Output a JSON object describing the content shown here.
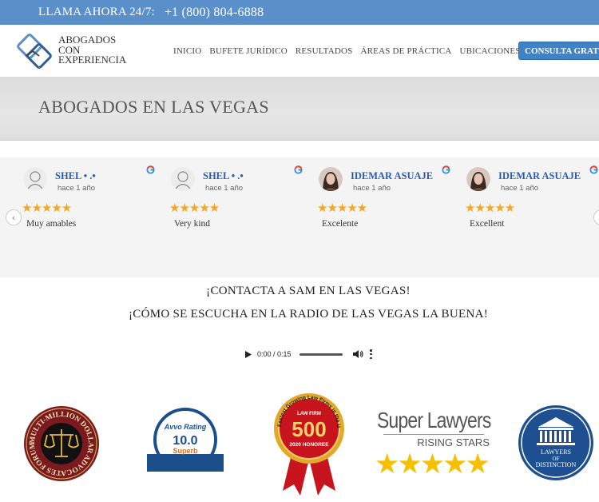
{
  "topbar": {
    "call_label": "LLAMA AHORA 24/7:",
    "phone": "+1 (800) 804-6888"
  },
  "header": {
    "logo_lines": [
      "ABOGADOS",
      "CON",
      "EXPERIENCIA"
    ],
    "nav": [
      "INICIO",
      "BUFETE JURÍDICO",
      "RESULTADOS",
      "ÁREAS DE PRÁCTICA",
      "UBICACIONES"
    ],
    "cta_label": "CONSULTA GRATIS"
  },
  "banner": {
    "title": "ABOGADOS EN LAS VEGAS"
  },
  "reviews": [
    {
      "name": "SHEL • .•",
      "time": "hace 1 año",
      "stars": "★★★★★",
      "text": "Muy amables"
    },
    {
      "name": "SHEL • .•",
      "time": "hace 1 año",
      "stars": "★★★★★",
      "text": "Very kind"
    },
    {
      "name": "IDEMAR ASUAJE",
      "time": "hace 1 año",
      "stars": "★★★★★",
      "text": "Excelente"
    },
    {
      "name": "IDEMAR ASUAJE",
      "time": "hace 1 año",
      "stars": "★★★★★",
      "text": "Excellent"
    }
  ],
  "contact": {
    "line1": "¡CONTACTA A SAM EN LAS VEGAS!",
    "line2": "¡CÓMO SE ESCUCHA EN LA RADIO DE LAS VEGAS LA BUENA!"
  },
  "audio": {
    "time": "0:00 / 0:15"
  },
  "badges": {
    "mmdaf_text": "MULTI-MILLION DOLLAR ADVOCATES FORUM",
    "avvo_label": "Avvo Rating",
    "avvo_score": "10.0",
    "avvo_word": "Superb",
    "lawfirm_top": "Fastest Growing Law Firms in the U.S.",
    "lawfirm_tag": "LAW FIRM",
    "lawfirm_num": "500",
    "lawfirm_honoree": "2020 HONOREE",
    "superlawyers_title": "Super Lawyers",
    "superlawyers_sub": "RISING STARS",
    "superlawyers_stars": "★★★★★",
    "distinction_lines": [
      "LAWYERS",
      "OF",
      "DISTINCTION"
    ]
  },
  "colors": {
    "topbar": "#5b8fc9",
    "cta": "#3f83c6",
    "star": "#f5a623",
    "reviewer_name": "#2a5db0"
  }
}
